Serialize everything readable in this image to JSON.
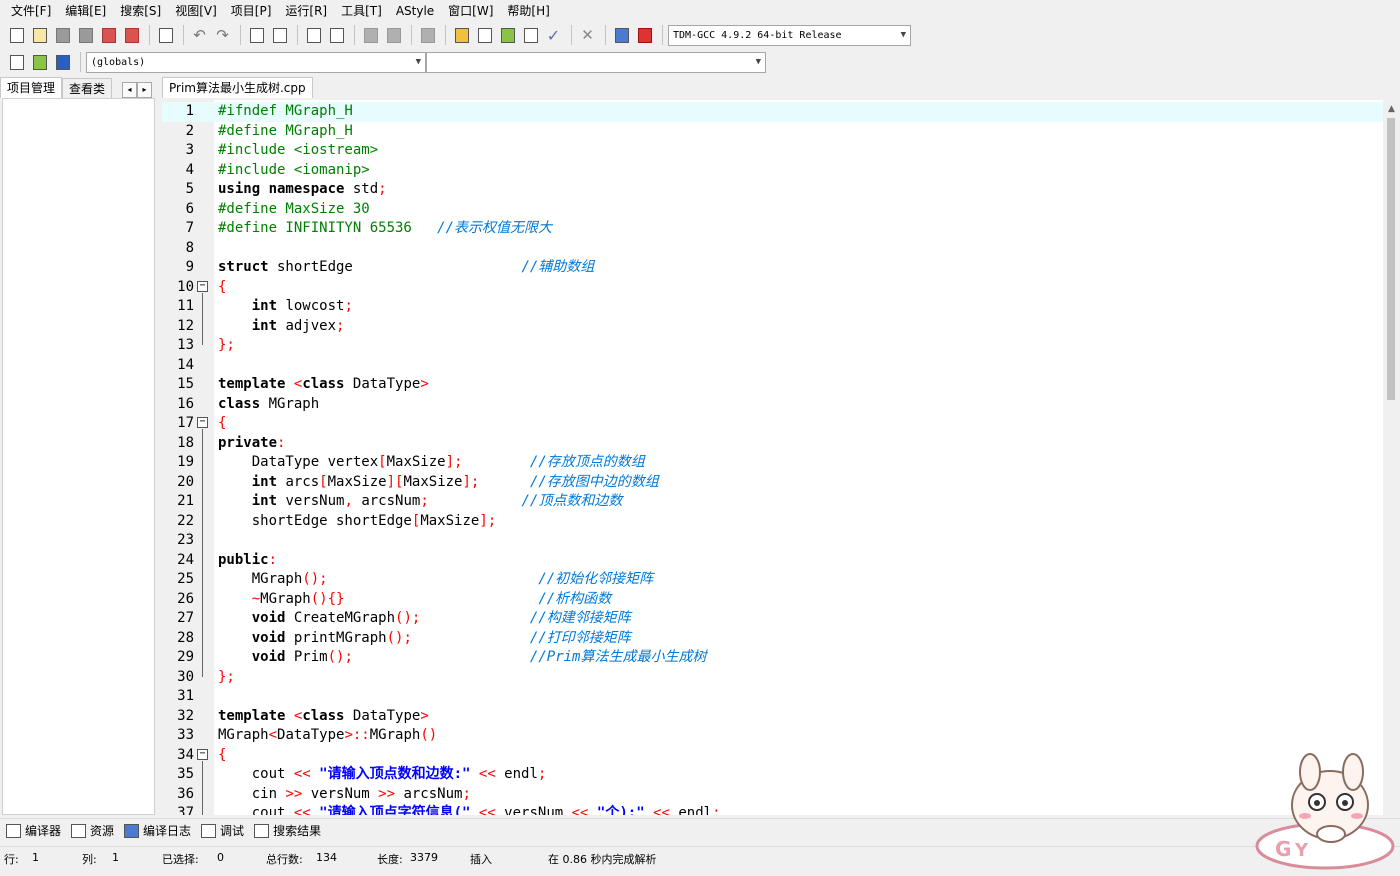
{
  "menu": [
    "文件[F]",
    "编辑[E]",
    "搜索[S]",
    "视图[V]",
    "项目[P]",
    "运行[R]",
    "工具[T]",
    "AStyle",
    "窗口[W]",
    "帮助[H]"
  ],
  "toolbar": {
    "compiler_select": "TDM-GCC 4.9.2 64-bit Release",
    "scope_select": "(globals)",
    "function_select": ""
  },
  "left_tabs": [
    "项目管理",
    "查看类"
  ],
  "left_tab_arrows": [
    "◂",
    "▸"
  ],
  "editor": {
    "file_tab": "Prim算法最小生成树.cpp"
  },
  "code_lines": [
    {
      "n": "1",
      "html": "<span class='pp'>#ifndef MGraph_H</span>"
    },
    {
      "n": "2",
      "html": "<span class='pp'>#define MGraph_H</span>"
    },
    {
      "n": "3",
      "html": "<span class='pp'>#include &lt;iostream&gt;</span>"
    },
    {
      "n": "4",
      "html": "<span class='pp'>#include &lt;iomanip&gt;</span>"
    },
    {
      "n": "5",
      "html": "<span class='kw'>using namespace</span> std<span class='sym'>;</span>"
    },
    {
      "n": "6",
      "html": "<span class='pp'>#define MaxSize 30</span>"
    },
    {
      "n": "7",
      "html": "<span class='pp'>#define INFINITYN 65536   </span><span class='cmt'>//表示权值无限大</span>"
    },
    {
      "n": "8",
      "html": ""
    },
    {
      "n": "9",
      "html": "<span class='kw'>struct</span> shortEdge                    <span class='cmt'>//辅助数组</span>"
    },
    {
      "n": "10",
      "html": "<span class='sym'>{</span>"
    },
    {
      "n": "11",
      "html": "    <span class='kw'>int</span> lowcost<span class='sym'>;</span>"
    },
    {
      "n": "12",
      "html": "    <span class='kw'>int</span> adjvex<span class='sym'>;</span>"
    },
    {
      "n": "13",
      "html": "<span class='sym'>};</span>"
    },
    {
      "n": "14",
      "html": ""
    },
    {
      "n": "15",
      "html": "<span class='kw'>template</span> <span class='sym'>&lt;</span><span class='kw'>class</span> DataType<span class='sym'>&gt;</span>"
    },
    {
      "n": "16",
      "html": "<span class='kw'>class</span> MGraph"
    },
    {
      "n": "17",
      "html": "<span class='sym'>{</span>"
    },
    {
      "n": "18",
      "html": "<span class='kw'>private</span><span class='sym'>:</span>"
    },
    {
      "n": "19",
      "html": "    DataType vertex<span class='sym'>[</span>MaxSize<span class='sym'>];</span>        <span class='cmt'>//存放顶点的数组</span>"
    },
    {
      "n": "20",
      "html": "    <span class='kw'>int</span> arcs<span class='sym'>[</span>MaxSize<span class='sym'>][</span>MaxSize<span class='sym'>];</span>      <span class='cmt'>//存放图中边的数组</span>"
    },
    {
      "n": "21",
      "html": "    <span class='kw'>int</span> versNum<span class='sym'>,</span> arcsNum<span class='sym'>;</span>           <span class='cmt'>//顶点数和边数</span>"
    },
    {
      "n": "22",
      "html": "    shortEdge shortEdge<span class='sym'>[</span>MaxSize<span class='sym'>];</span>"
    },
    {
      "n": "23",
      "html": ""
    },
    {
      "n": "24",
      "html": "<span class='kw'>public</span><span class='sym'>:</span>"
    },
    {
      "n": "25",
      "html": "    MGraph<span class='sym'>();</span>                         <span class='cmt'>//初始化邻接矩阵</span>"
    },
    {
      "n": "26",
      "html": "    <span class='sym'>~</span>MGraph<span class='sym'>(){}</span>                       <span class='cmt'>//析构函数</span>"
    },
    {
      "n": "27",
      "html": "    <span class='kw'>void</span> CreateMGraph<span class='sym'>();</span>             <span class='cmt'>//构建邻接矩阵</span>"
    },
    {
      "n": "28",
      "html": "    <span class='kw'>void</span> printMGraph<span class='sym'>();</span>              <span class='cmt'>//打印邻接矩阵</span>"
    },
    {
      "n": "29",
      "html": "    <span class='kw'>void</span> Prim<span class='sym'>();</span>                     <span class='cmt'>//Prim算法生成最小生成树</span>"
    },
    {
      "n": "30",
      "html": "<span class='sym'>};</span>"
    },
    {
      "n": "31",
      "html": ""
    },
    {
      "n": "32",
      "html": "<span class='kw'>template</span> <span class='sym'>&lt;</span><span class='kw'>class</span> DataType<span class='sym'>&gt;</span>"
    },
    {
      "n": "33",
      "html": "MGraph<span class='sym'>&lt;</span>DataType<span class='sym'>&gt;::</span>MGraph<span class='sym'>()</span>"
    },
    {
      "n": "34",
      "html": "<span class='sym'>{</span>"
    },
    {
      "n": "35",
      "html": "    cout <span class='sym'>&lt;&lt;</span> <span class='str'>\"请输入顶点数和边数:\"</span> <span class='sym'>&lt;&lt;</span> endl<span class='sym'>;</span>"
    },
    {
      "n": "36",
      "html": "    cin <span class='sym'>&gt;&gt;</span> versNum <span class='sym'>&gt;&gt;</span> arcsNum<span class='sym'>;</span>"
    },
    {
      "n": "37",
      "html": "    cout <span class='sym'>&lt;&lt;</span> <span class='str'>\"请输入顶点字符信息(\"</span> <span class='sym'>&lt;&lt;</span> versNum <span class='sym'>&lt;&lt;</span> <span class='str'>\"个):\"</span> <span class='sym'>&lt;&lt;</span> endl<span class='sym'>;</span>"
    }
  ],
  "folds": [
    "10",
    "17",
    "34"
  ],
  "bottom_tabs": [
    {
      "label": "编译器",
      "icon": "compiler-icon"
    },
    {
      "label": "资源",
      "icon": "resources-icon"
    },
    {
      "label": "编译日志",
      "icon": "compile-log-icon"
    },
    {
      "label": "调试",
      "icon": "debug-icon"
    },
    {
      "label": "搜索结果",
      "icon": "search-results-icon"
    }
  ],
  "status": {
    "row_label": "行:",
    "row": "1",
    "col_label": "列:",
    "col": "1",
    "sel_label": "已选择:",
    "sel": "0",
    "lines_label": "总行数:",
    "lines": "134",
    "len_label": "长度:",
    "len": "3379",
    "mode": "插入",
    "parse": "在 0.86 秒内完成解析"
  },
  "colors": {
    "preprocessor": "#008000",
    "symbol": "#ff0000",
    "comment": "#0078d7",
    "string": "#0000ff",
    "current_line": "#e6fcff"
  }
}
